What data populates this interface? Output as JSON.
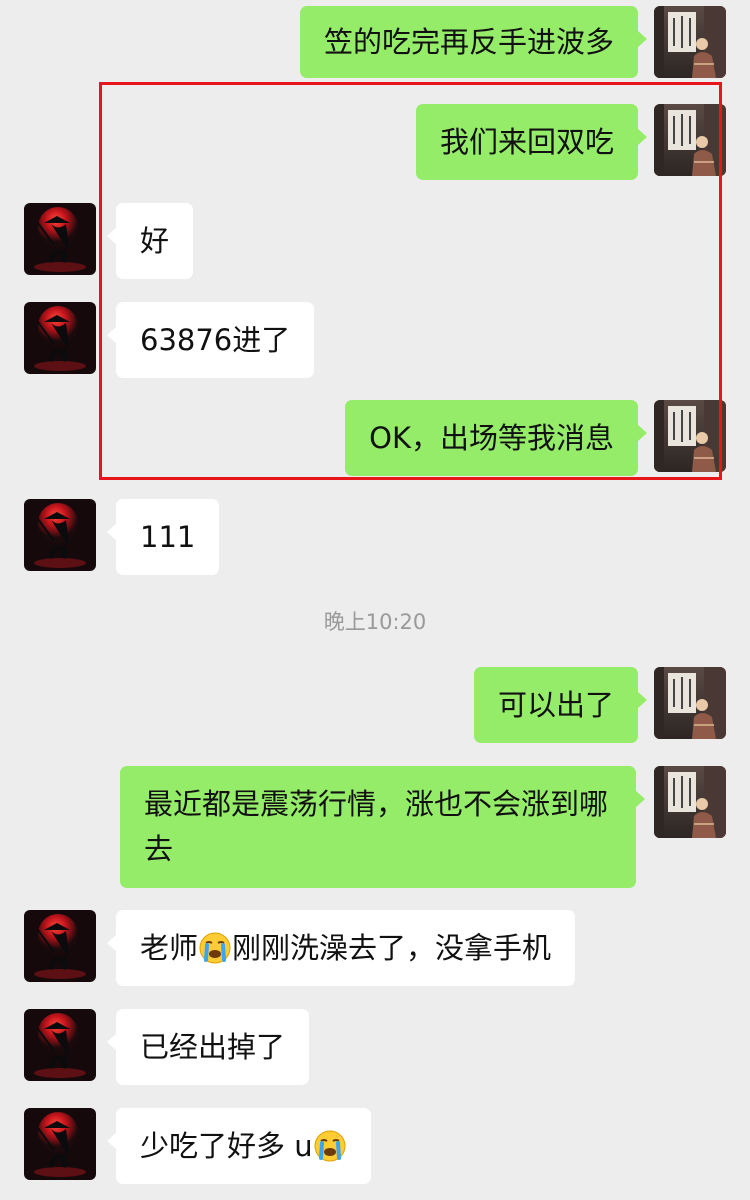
{
  "messages": [
    {
      "side": "out",
      "text": "笠的吃完再反手进波多"
    },
    {
      "side": "out",
      "text": "我们来回双吃"
    },
    {
      "side": "in",
      "text": "好"
    },
    {
      "side": "in",
      "text": "63876进了"
    },
    {
      "side": "out",
      "text": "OK，出场等我消息"
    },
    {
      "side": "in",
      "text": "111"
    },
    {
      "side": "out",
      "text": "可以出了"
    },
    {
      "side": "out",
      "text": "最近都是震荡行情，涨也不会涨到哪去"
    },
    {
      "side": "in",
      "text_before": "老师",
      "emoji": "loudly-crying-face-emoji",
      "text_after": "刚刚洗澡去了，没拿手机"
    },
    {
      "side": "in",
      "text": "已经出掉了"
    },
    {
      "side": "in",
      "text_before": "少吃了好多 u",
      "emoji": "loudly-crying-face-emoji",
      "text_after": ""
    }
  ],
  "timestamp": "晚上10:20",
  "highlight_color": "#e8161b",
  "colors": {
    "background": "#ededed",
    "outgoing_bubble": "#95ec69",
    "incoming_bubble": "#ffffff",
    "timestamp_text": "#999999"
  }
}
